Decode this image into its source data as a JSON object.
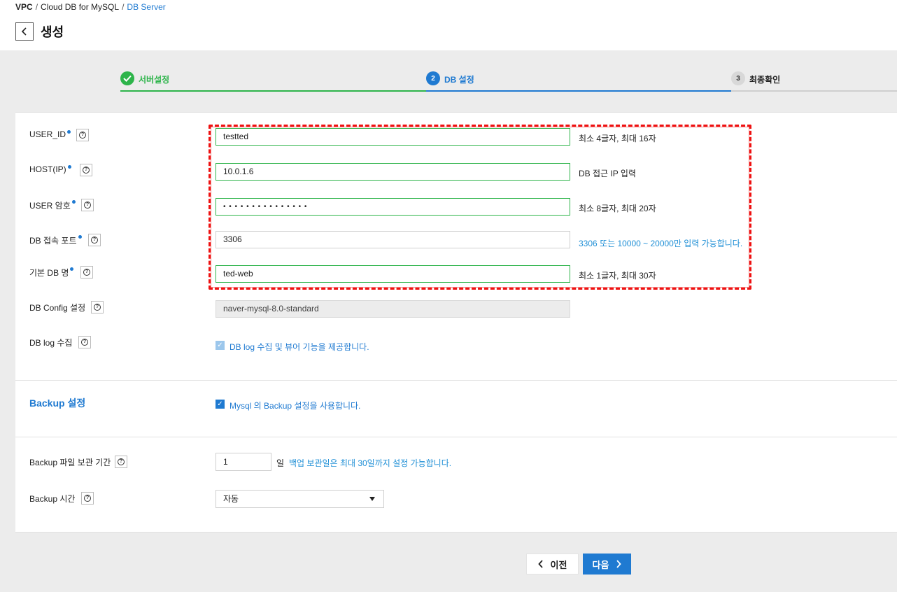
{
  "breadcrumb": [
    "VPC",
    "Cloud DB for MySQL",
    "DB Server"
  ],
  "page": {
    "title": "생성"
  },
  "steps": [
    {
      "num": "1",
      "label": "서버설정",
      "state": "done"
    },
    {
      "num": "2",
      "label": "DB 설정",
      "state": "active"
    },
    {
      "num": "3",
      "label": "최종확인",
      "state": "todo"
    }
  ],
  "form": {
    "user_id": {
      "label": "USER_ID",
      "value": "testted",
      "hint": "최소 4글자, 최대 16자"
    },
    "host": {
      "label": "HOST(IP)",
      "value": "10.0.1.6",
      "hint": "DB 접근 IP 입력"
    },
    "password": {
      "label": "USER 암호",
      "value": "• • • • • • • • • • • • • • •",
      "hint": "최소 8글자, 최대 20자"
    },
    "port": {
      "label": "DB 접속 포트",
      "value": "3306",
      "hint": "3306 또는 10000 ~ 20000만 입력 가능합니다."
    },
    "db_name": {
      "label": "기본 DB 명",
      "value": "ted-web",
      "hint": "최소 1글자, 최대 30자"
    },
    "config": {
      "label": "DB Config 설정",
      "value": "naver-mysql-8.0-standard"
    },
    "log": {
      "label": "DB log 수집",
      "checkbox_text": "DB log 수집 및 뷰어 기능을 제공합니다."
    }
  },
  "backup": {
    "section_title": "Backup 설정",
    "checkbox_text": "Mysql 의 Backup 설정을 사용합니다.",
    "retention": {
      "label": "Backup 파일 보관 기간",
      "value": "1",
      "unit": "일",
      "hint": "백업 보관일은 최대 30일까지 설정 가능합니다."
    },
    "time": {
      "label": "Backup 시간",
      "value": "자동"
    }
  },
  "buttons": {
    "prev": "이전",
    "next": "다음"
  },
  "colors": {
    "accent": "#1f7ad1",
    "success": "#2db44a",
    "highlight": "#ee1111"
  }
}
